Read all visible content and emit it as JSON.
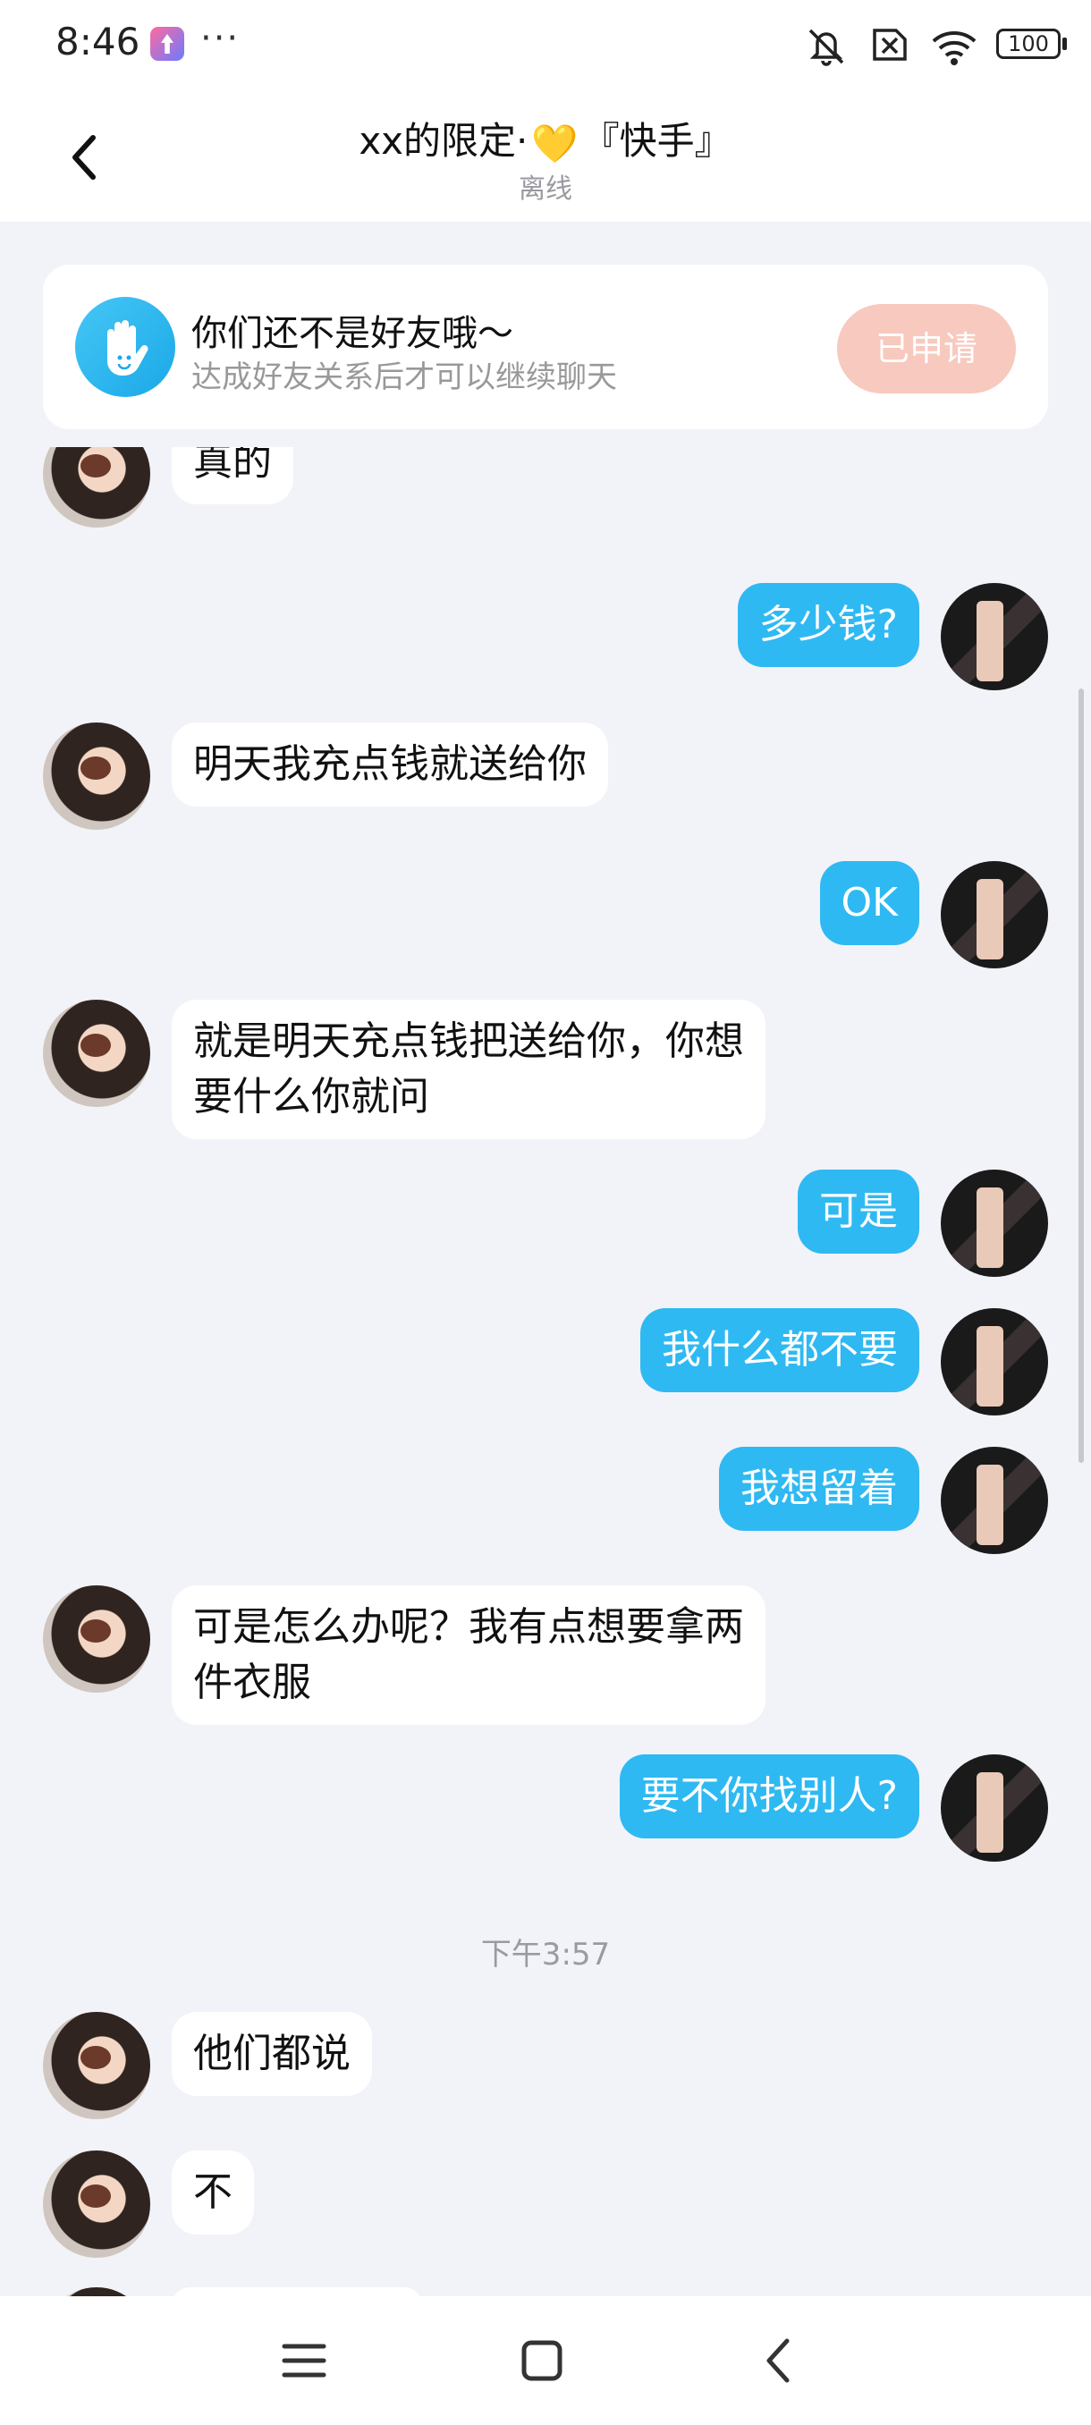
{
  "status_bar": {
    "time": "8:46",
    "dots": "···",
    "battery": "100",
    "icons": [
      "app-notification-icon",
      "mute-icon",
      "no-sim-icon",
      "wifi-icon",
      "battery-icon"
    ]
  },
  "header": {
    "title_prefix": "xx的限定·",
    "title_emoji": "💛",
    "title_suffix": "『快手』",
    "subtitle": "离线"
  },
  "friend_card": {
    "title": "你们还不是好友哦～",
    "subtitle": "达成好友关系后才可以继续聊天",
    "button": "已申请"
  },
  "messages": [
    {
      "side": "left",
      "text": "真的"
    },
    {
      "side": "right",
      "text": "多少钱?"
    },
    {
      "side": "left",
      "text": "明天我充点钱就送给你"
    },
    {
      "side": "right",
      "text": "OK"
    },
    {
      "side": "left",
      "text": "就是明天充点钱把送给你，你想\n要什么你就问"
    },
    {
      "side": "right",
      "text": "可是"
    },
    {
      "side": "right",
      "text": "我什么都不要"
    },
    {
      "side": "right",
      "text": "我想留着"
    },
    {
      "side": "left",
      "text": "可是怎么办呢？我有点想要拿两\n件衣服"
    },
    {
      "side": "right",
      "text": "要不你找别人?"
    },
    {
      "side": "time",
      "text": "下午3:57"
    },
    {
      "side": "left",
      "text": "他们都说"
    },
    {
      "side": "left",
      "text": "不"
    }
  ],
  "colors": {
    "accent": "#2FB9F2",
    "background": "#F2F3F8",
    "button_applied": "#F8C9BE"
  }
}
